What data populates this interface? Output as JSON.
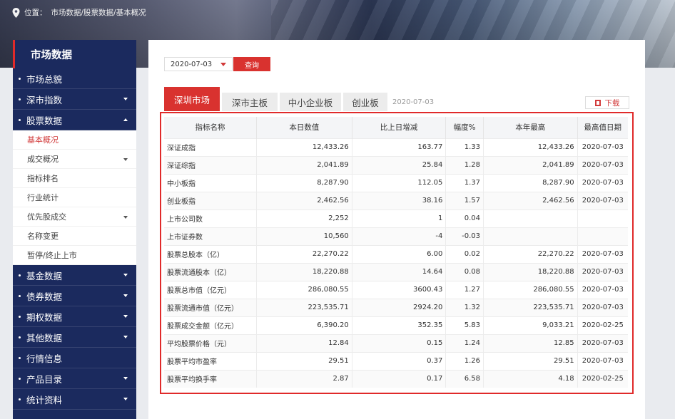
{
  "breadcrumb": {
    "prefix": "位置：",
    "path": "市场数据/股票数据/基本概况"
  },
  "icons": {
    "location": "map-pin-icon",
    "download": "pdf-icon"
  },
  "colors": {
    "accent": "#d9322f",
    "sidebar": "#1b2a5e"
  },
  "sidebar": {
    "title": "市场数据",
    "items": [
      {
        "label": "市场总貌",
        "caret": ""
      },
      {
        "label": "深市指数",
        "caret": "down"
      },
      {
        "label": "股票数据",
        "caret": "up"
      }
    ],
    "sub_items": [
      {
        "label": "基本概况",
        "active": true,
        "caret": ""
      },
      {
        "label": "成交概况",
        "active": false,
        "caret": "down"
      },
      {
        "label": "指标排名",
        "active": false,
        "caret": ""
      },
      {
        "label": "行业统计",
        "active": false,
        "caret": ""
      },
      {
        "label": "优先股成交",
        "active": false,
        "caret": "down"
      },
      {
        "label": "名称变更",
        "active": false,
        "caret": ""
      },
      {
        "label": "暂停/终止上市",
        "active": false,
        "caret": ""
      }
    ],
    "items_after": [
      {
        "label": "基金数据",
        "caret": "down"
      },
      {
        "label": "债券数据",
        "caret": "down"
      },
      {
        "label": "期权数据",
        "caret": "down"
      },
      {
        "label": "其他数据",
        "caret": "down"
      },
      {
        "label": "行情信息",
        "caret": ""
      },
      {
        "label": "产品目录",
        "caret": "down"
      },
      {
        "label": "统计资料",
        "caret": "down"
      }
    ]
  },
  "filter": {
    "date_value": "2020-07-03",
    "query_label": "查询"
  },
  "tabs": [
    {
      "label": "深圳市场",
      "active": true
    },
    {
      "label": "深市主板",
      "active": false
    },
    {
      "label": "中小企业板",
      "active": false
    },
    {
      "label": "创业板",
      "active": false
    }
  ],
  "tab_date": "2020-07-03",
  "download_label": "下载",
  "table": {
    "headers": [
      "指标名称",
      "本日数值",
      "比上日增减",
      "幅度%",
      "本年最高",
      "最高值日期"
    ],
    "rows": [
      [
        "深证成指",
        "12,433.26",
        "163.77",
        "1.33",
        "12,433.26",
        "2020-07-03"
      ],
      [
        "深证综指",
        "2,041.89",
        "25.84",
        "1.28",
        "2,041.89",
        "2020-07-03"
      ],
      [
        "中小板指",
        "8,287.90",
        "112.05",
        "1.37",
        "8,287.90",
        "2020-07-03"
      ],
      [
        "创业板指",
        "2,462.56",
        "38.16",
        "1.57",
        "2,462.56",
        "2020-07-03"
      ],
      [
        "上市公司数",
        "2,252",
        "1",
        "0.04",
        "",
        ""
      ],
      [
        "上市证券数",
        "10,560",
        "-4",
        "-0.03",
        "",
        ""
      ],
      [
        "股票总股本（亿）",
        "22,270.22",
        "6.00",
        "0.02",
        "22,270.22",
        "2020-07-03"
      ],
      [
        "股票流通股本（亿）",
        "18,220.88",
        "14.64",
        "0.08",
        "18,220.88",
        "2020-07-03"
      ],
      [
        "股票总市值（亿元）",
        "286,080.55",
        "3600.43",
        "1.27",
        "286,080.55",
        "2020-07-03"
      ],
      [
        "股票流通市值（亿元）",
        "223,535.71",
        "2924.20",
        "1.32",
        "223,535.71",
        "2020-07-03"
      ],
      [
        "股票成交金额（亿元）",
        "6,390.20",
        "352.35",
        "5.83",
        "9,033.21",
        "2020-02-25"
      ],
      [
        "平均股票价格（元）",
        "12.84",
        "0.15",
        "1.24",
        "12.85",
        "2020-07-03"
      ],
      [
        "股票平均市盈率",
        "29.51",
        "0.37",
        "1.26",
        "29.51",
        "2020-07-03"
      ],
      [
        "股票平均换手率",
        "2.87",
        "0.17",
        "6.58",
        "4.18",
        "2020-02-25"
      ]
    ]
  }
}
